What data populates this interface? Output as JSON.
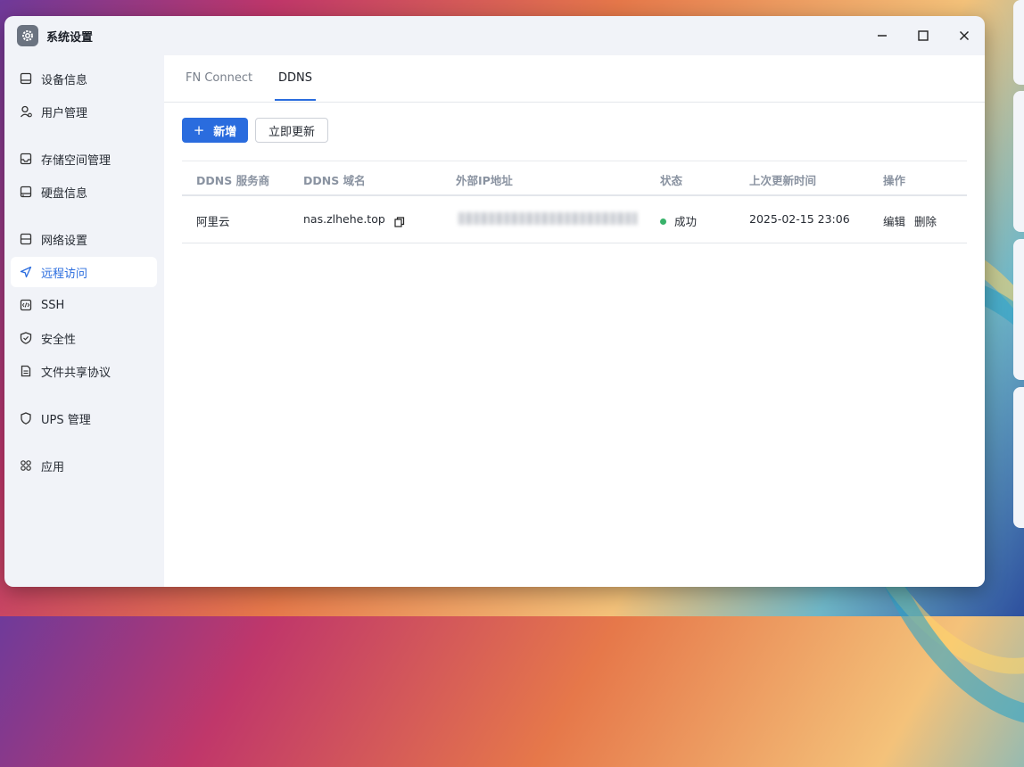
{
  "window": {
    "title": "系统设置"
  },
  "sidebar": {
    "items": [
      {
        "label": "设备信息",
        "icon": "device-icon"
      },
      {
        "label": "用户管理",
        "icon": "user-icon"
      },
      {
        "label": "存储空间管理",
        "icon": "storage-icon"
      },
      {
        "label": "硬盘信息",
        "icon": "disk-icon"
      },
      {
        "label": "网络设置",
        "icon": "network-icon"
      },
      {
        "label": "远程访问",
        "icon": "send-icon",
        "active": true
      },
      {
        "label": "SSH",
        "icon": "code-icon"
      },
      {
        "label": "安全性",
        "icon": "shield-check-icon"
      },
      {
        "label": "文件共享协议",
        "icon": "file-icon"
      },
      {
        "label": "UPS 管理",
        "icon": "shield-icon"
      },
      {
        "label": "应用",
        "icon": "command-icon"
      }
    ]
  },
  "tabs": [
    {
      "label": "FN Connect"
    },
    {
      "label": "DDNS",
      "active": true
    }
  ],
  "toolbar": {
    "add_label": "新增",
    "add_plus": "+",
    "refresh_label": "立即更新"
  },
  "table": {
    "headers": [
      "DDNS 服务商",
      "DDNS 域名",
      "外部IP地址",
      "状态",
      "上次更新时间",
      "操作"
    ],
    "rows": [
      {
        "provider": "阿里云",
        "domain": "nas.zlhehe.top",
        "status": "成功",
        "updated": "2025-02-15 23:06",
        "edit": "编辑",
        "delete": "删除"
      }
    ]
  },
  "colors": {
    "accent": "#2a6cde",
    "success": "#38b26a"
  }
}
